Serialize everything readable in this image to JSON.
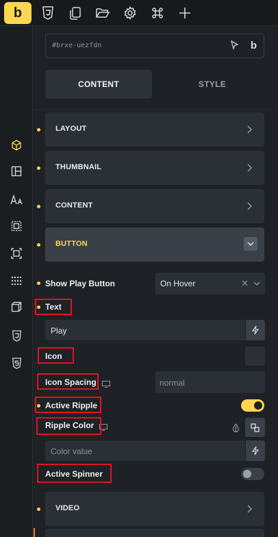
{
  "logo_letter": "b",
  "topbar_icons": [
    "css3-icon",
    "copy-icon",
    "folder-open-icon",
    "gear-icon",
    "command-icon",
    "plus-icon"
  ],
  "rail_icons": [
    "cube-icon",
    "layout-icon",
    "typography-icon",
    "box-dashed-icon",
    "frame-icon",
    "grid-dots-icon",
    "box-3d-icon",
    "css3-icon",
    "html5-icon"
  ],
  "element_id": "#brxe-uezfdn",
  "id_badge": "b",
  "tabs": {
    "content": "CONTENT",
    "style": "STYLE"
  },
  "sections": {
    "layout": "LAYOUT",
    "thumbnail": "THUMBNAIL",
    "content": "CONTENT",
    "button": "BUTTON",
    "video": "VIDEO"
  },
  "fields": {
    "show_play_button": {
      "label": "Show Play Button",
      "value": "On Hover"
    },
    "text": {
      "label": "Text",
      "value": "Play"
    },
    "icon": {
      "label": "Icon"
    },
    "icon_spacing": {
      "label": "Icon Spacing",
      "placeholder": "normal"
    },
    "active_ripple": {
      "label": "Active Ripple",
      "on": true
    },
    "ripple_color": {
      "label": "Ripple Color",
      "placeholder": "Color value"
    },
    "active_spinner": {
      "label": "Active Spinner",
      "on": false
    }
  },
  "colors": {
    "accent": "#ffd64f",
    "highlight": "#e1141b",
    "panel": "#1e2125",
    "control": "#2b3036"
  }
}
